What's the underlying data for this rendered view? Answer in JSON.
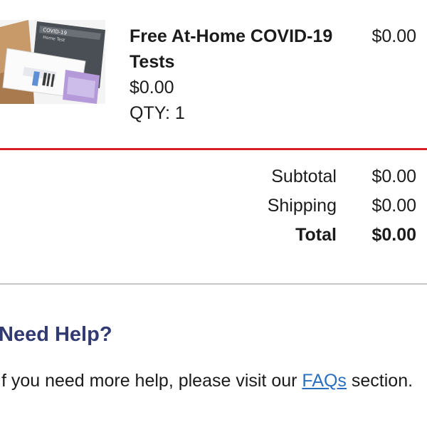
{
  "product": {
    "image_icon": "covid-test-kit-image",
    "name": "Free At-Home COVID-19 Tests",
    "price": "$0.00",
    "qty_label": "QTY: 1",
    "line_total": "$0.00"
  },
  "summary": {
    "subtotal_label": "Subtotal",
    "subtotal_value": "$0.00",
    "shipping_label": "Shipping",
    "shipping_value": "$0.00",
    "total_label": "Total",
    "total_value": "$0.00"
  },
  "help": {
    "heading": "Need Help?",
    "text_before": "If you need more help, please visit our ",
    "link_text": "FAQs",
    "text_after": " section."
  },
  "colors": {
    "divider_red": "#d61f26",
    "heading_navy": "#323a72",
    "link_blue": "#2a6fbf"
  }
}
